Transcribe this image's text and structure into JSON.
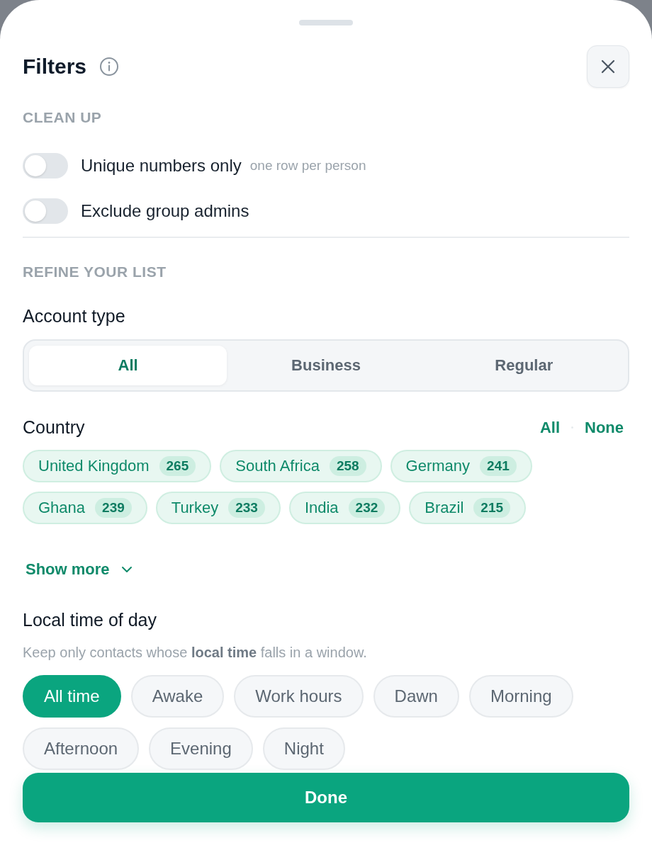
{
  "header": {
    "title": "Filters"
  },
  "clean_up": {
    "heading": "CLEAN UP",
    "toggles": [
      {
        "label": "Unique numbers only",
        "hint": "one row per person",
        "on": false
      },
      {
        "label": "Exclude group admins",
        "on": false
      }
    ]
  },
  "refine": {
    "heading": "REFINE YOUR LIST"
  },
  "account_type": {
    "label": "Account type",
    "options": [
      {
        "label": "All",
        "selected": true
      },
      {
        "label": "Business",
        "selected": false
      },
      {
        "label": "Regular",
        "selected": false
      }
    ]
  },
  "country": {
    "label": "Country",
    "actions": [
      "All",
      "None"
    ],
    "chips": [
      {
        "label": "United Kingdom",
        "count": "265",
        "selected": true
      },
      {
        "label": "South Africa",
        "count": "258",
        "selected": true
      },
      {
        "label": "Germany",
        "count": "241",
        "selected": true
      },
      {
        "label": "Ghana",
        "count": "239",
        "selected": true
      },
      {
        "label": "Turkey",
        "count": "233",
        "selected": true
      },
      {
        "label": "India",
        "count": "232",
        "selected": true
      },
      {
        "label": "Brazil",
        "count": "215",
        "selected": true
      }
    ],
    "show_more": "Show more"
  },
  "local_time": {
    "label": "Local time of day",
    "description": "Keep only contacts whose **local time** falls in a window.",
    "chips": [
      {
        "label": "All time",
        "selected": true
      },
      {
        "label": "Awake",
        "selected": false
      },
      {
        "label": "Work hours",
        "selected": false
      },
      {
        "label": "Dawn",
        "selected": false
      },
      {
        "label": "Morning",
        "selected": false
      },
      {
        "label": "Afternoon",
        "selected": false
      },
      {
        "label": "Evening",
        "selected": false
      },
      {
        "label": "Night",
        "selected": false
      }
    ]
  },
  "done_button": "Done"
}
